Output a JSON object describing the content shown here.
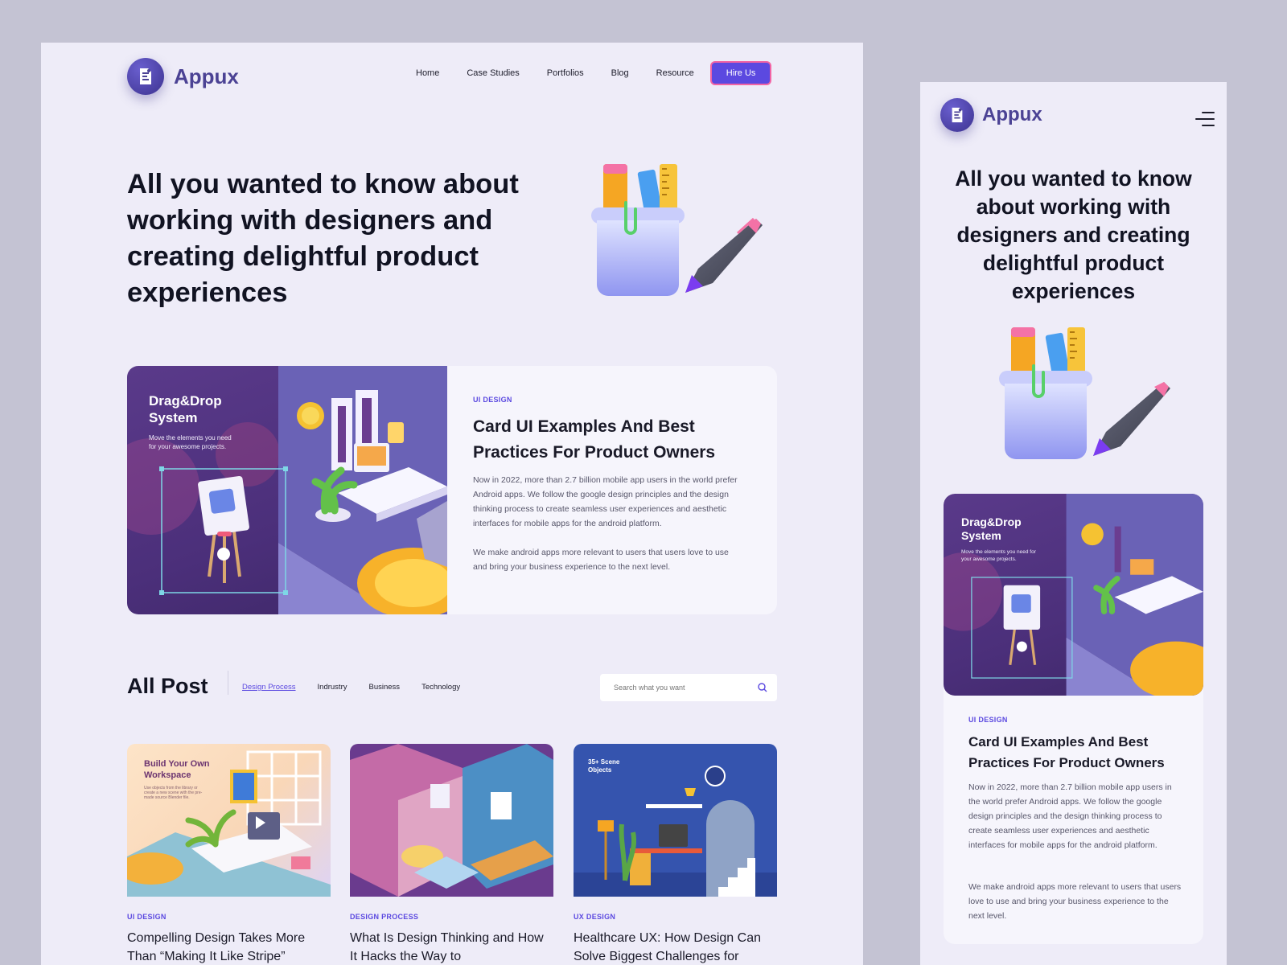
{
  "brand": {
    "name": "Appux"
  },
  "nav": {
    "items": [
      "Home",
      "Case Studies",
      "Portfolios",
      "Blog",
      "Resource"
    ],
    "cta": "Hire Us"
  },
  "hero": {
    "title": "All you wanted to know about working with designers and creating delightful product experiences"
  },
  "featured": {
    "art_title": "Drag&Drop System",
    "art_subtitle": "Move the elements you need for your awesome projects.",
    "category": "UI DESIGN",
    "title": "Card UI Examples And Best Practices For Product Owners",
    "body1": "Now in 2022, more than 2.7 billion mobile app users in the world prefer Android apps. We follow the google design principles and the design thinking process to create seamless user experiences and aesthetic interfaces for mobile apps for the android platform.",
    "body2": "We make android apps more relevant to users that users love to use and bring your business experience to the next level."
  },
  "all_post": {
    "heading": "All Post",
    "filters": [
      "Design Process",
      "Indrustry",
      "Business",
      "Technology"
    ],
    "active_filter": "Design Process",
    "search_placeholder": "Search what you want"
  },
  "posts": [
    {
      "category": "UI DESIGN",
      "title": "Compelling Design Takes More Than “Making It Like Stripe”",
      "thumb_title": "Build Your Own Workspace",
      "thumb_sub": "Use objects from the library or create a new scene with the pre-made source Blender file."
    },
    {
      "category": "DESIGN PROCESS",
      "title": "What Is Design Thinking and How It Hacks the Way to"
    },
    {
      "category": "UX DESIGN",
      "title": "Healthcare UX: How Design Can Solve Biggest Challenges for",
      "thumb_title": "35+ Scene Objects"
    }
  ],
  "colors": {
    "accent": "#5b49e0",
    "accent_outline": "#f264a4",
    "page": "#eeecf8",
    "backdrop": "#c4c3d3"
  }
}
